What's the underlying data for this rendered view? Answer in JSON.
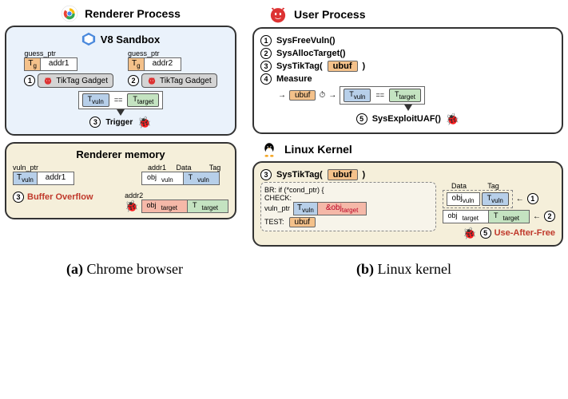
{
  "header_a": "Renderer Process",
  "header_b": "User Process",
  "v8_title": "V8 Sandbox",
  "renderer_mem_title": "Renderer memory",
  "kernel_title": "Linux Kernel",
  "guess_ptr": "guess_ptr",
  "vuln_ptr": "vuln_ptr",
  "Tg": "T_g",
  "addr1": "addr1",
  "addr2": "addr2",
  "tiktag": "TikTag Gadget",
  "Tvuln": "T_vuln",
  "Ttarget": "T_target",
  "eq": "==",
  "trigger": "Trigger",
  "buffer_overflow": "Buffer Overflow",
  "obj_vuln": "obj_vuln",
  "obj_target": "obj_target",
  "data_hdr": "Data",
  "tag_hdr": "Tag",
  "steps": {
    "s1": "SysFreeVuln()",
    "s2": "SysAllocTarget()",
    "s3": "SysTikTag(",
    "s3b": ")",
    "s4": "Measure",
    "s5": "SysExploitUAF()"
  },
  "ubuf": "ubuf",
  "uaf": "Use-After-Free",
  "kernel_box": {
    "br": "BR: if (*cond_ptr) {",
    "check": "CHECK:",
    "test": "TEST:"
  },
  "and_obj_target": "&obj_target",
  "caption_a": "(a) Chrome browser",
  "caption_b": "(b) Linux kernel",
  "nums": {
    "n1": "1",
    "n2": "2",
    "n3": "3",
    "n4": "4",
    "n5": "5"
  }
}
